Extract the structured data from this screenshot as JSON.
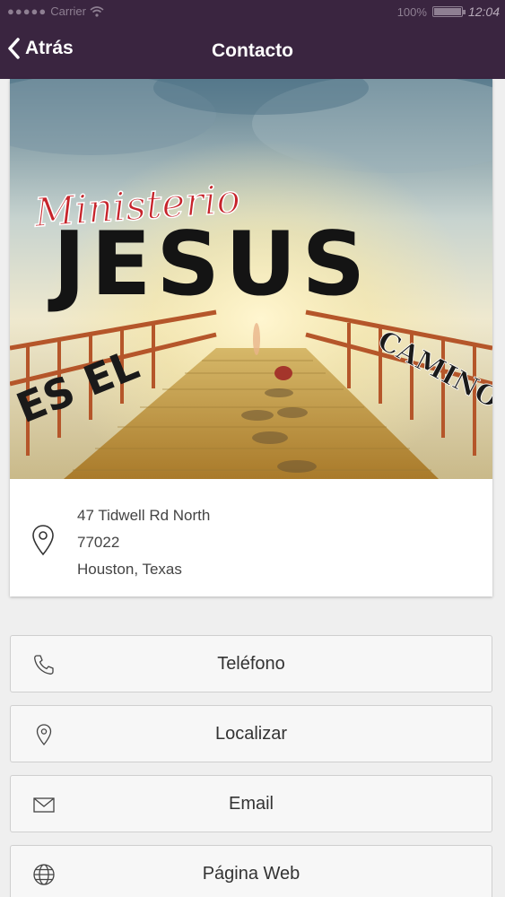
{
  "status_bar": {
    "carrier": "Carrier",
    "battery": "100%",
    "time": "12:04",
    "battery_level": 1.0
  },
  "nav": {
    "back_label": "Atrás",
    "title": "Contacto"
  },
  "hero": {
    "logo_text_top": "Ministerio",
    "logo_text_main": "JESUS",
    "logo_text_left": "ES EL",
    "logo_text_right": "CAMINO"
  },
  "address": {
    "line1": "47 Tidwell Rd North",
    "line2": "77022",
    "line3": "Houston, Texas",
    "icon": "location-pin-icon"
  },
  "actions": [
    {
      "label": "Teléfono",
      "icon": "phone-icon"
    },
    {
      "label": "Localizar",
      "icon": "location-pin-icon"
    },
    {
      "label": "Email",
      "icon": "envelope-icon"
    },
    {
      "label": "Página Web",
      "icon": "globe-icon"
    }
  ],
  "colors": {
    "nav_background": "#3a2540",
    "page_background": "#efefef"
  }
}
